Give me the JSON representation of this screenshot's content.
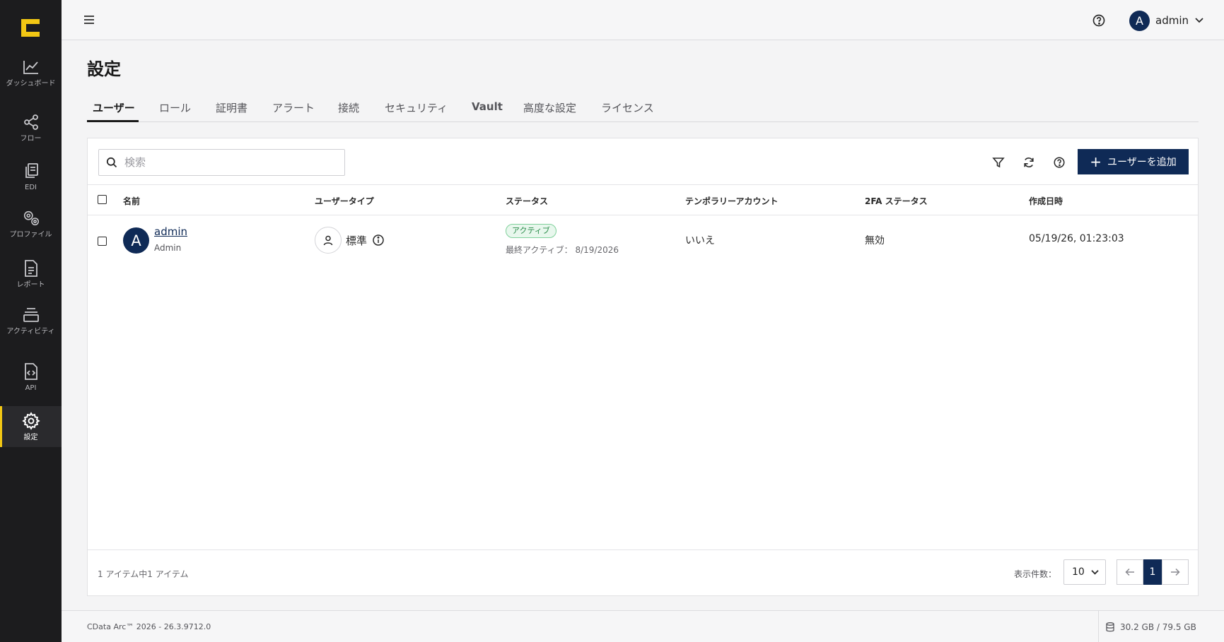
{
  "app": {
    "brand_color": "#f2c714",
    "accent_color": "#0f2a56",
    "version_text": "CData Arc™ 2026 - 26.3.9712.0",
    "storage_text": "30.2 GB / 79.5 GB"
  },
  "sidebar": {
    "items": [
      {
        "label": "ダッシュボード",
        "icon": "chart-line-icon"
      },
      {
        "label": "フロー",
        "icon": "share-nodes-icon"
      },
      {
        "label": "EDI",
        "icon": "documents-icon"
      },
      {
        "label": "プロファイル",
        "icon": "gears-icon"
      },
      {
        "label": "レポート",
        "icon": "report-icon"
      },
      {
        "label": "アクティビティ",
        "icon": "stack-icon"
      },
      {
        "label": "API",
        "icon": "code-file-icon"
      },
      {
        "label": "設定",
        "icon": "gear-icon",
        "active": true
      }
    ]
  },
  "topbar": {
    "user_initial": "A",
    "user_name": "admin"
  },
  "page": {
    "title": "設定",
    "tabs": [
      "ユーザー",
      "ロール",
      "証明書",
      "アラート",
      "接続",
      "セキュリティ",
      "Vault",
      "高度な設定",
      "ライセンス"
    ],
    "active_tab": "ユーザー"
  },
  "toolbar": {
    "search_placeholder": "検索",
    "add_user_label": "ユーザーを追加"
  },
  "table": {
    "columns": [
      "名前",
      "ユーザータイプ",
      "ステータス",
      "テンポラリーアカウント",
      "2FA ステータス",
      "作成日時"
    ],
    "rows": [
      {
        "initial": "A",
        "name": "admin",
        "role": "Admin",
        "user_type": "標準",
        "status_badge": "アクティブ",
        "last_active": "最終アクティブ： 8/19/2026",
        "temporary": "いいえ",
        "twofa": "無効",
        "created": "05/19/26, 01:23:03"
      }
    ]
  },
  "footer": {
    "item_count": "1 アイテム中1 アイテム",
    "per_page_label": "表示件数：",
    "per_page_value": "10",
    "current_page": "1"
  }
}
